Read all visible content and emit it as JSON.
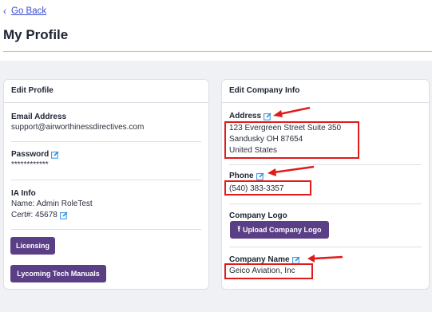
{
  "nav": {
    "back_label": "Go Back"
  },
  "page": {
    "title": "My Profile"
  },
  "edit_profile": {
    "header": "Edit Profile",
    "email_label": "Email Address",
    "email_value": "support@airworthinessdirectives.com",
    "password_label": "Password",
    "password_value": "************",
    "ia_label": "IA Info",
    "ia_name": "Name: Admin RoleTest",
    "ia_cert": "Cert#: 45678",
    "licensing_button": "Licensing",
    "manuals_button": "Lycoming Tech Manuals"
  },
  "edit_company": {
    "header": "Edit Company Info",
    "address_label": "Address",
    "address_lines": [
      "123 Evergreen Street Suite 350",
      "Sandusky OH 87654",
      "United States"
    ],
    "phone_label": "Phone",
    "phone_value": "(540) 383-3357",
    "logo_label": "Company Logo",
    "upload_button": "Upload Company Logo",
    "company_name_label": "Company Name",
    "company_name_value": "Geico Aviation, Inc"
  },
  "colors": {
    "accent": "#5a3e86",
    "link": "#3a4fd0",
    "annotation": "#e11a1a",
    "edit_icon": "#2f8fe0"
  },
  "icons": [
    "chevron-left-icon",
    "edit-icon",
    "upload-icon",
    "annotation-arrow"
  ]
}
